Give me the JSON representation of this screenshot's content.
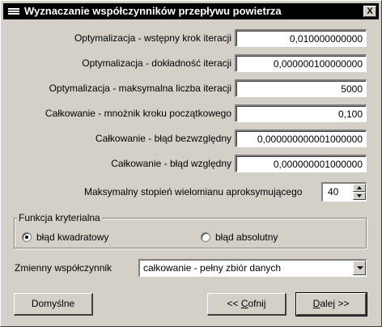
{
  "window": {
    "title": "Wyznaczanie współczynników przepływu powietrza",
    "close_label": "X",
    "icon": "app-menu-icon"
  },
  "fields": [
    {
      "label": "Optymalizacja - wstępny krok iteracji",
      "value": "0,010000000000"
    },
    {
      "label": "Optymalizacja - dokładność iteracji",
      "value": "0,000000100000000"
    },
    {
      "label": "Optymalizacja - maksymalna liczba iteracji",
      "value": "5000"
    },
    {
      "label": "Całkowanie - mnożnik kroku początkowego",
      "value": "0,100"
    },
    {
      "label": "Całkowanie - błąd bezwzględny",
      "value": "0,000000000001000000"
    },
    {
      "label": "Całkowanie - błąd względny",
      "value": "0,000000001000000"
    }
  ],
  "spinner": {
    "label": "Maksymalny stopień wielomianu aproksymującego",
    "value": "40"
  },
  "criterion_group": {
    "title": "Funkcja kryterialna",
    "options": [
      {
        "label": "błąd kwadratowy",
        "selected": true
      },
      {
        "label": "błąd absolutny",
        "selected": false
      }
    ]
  },
  "variable_combo": {
    "label": "Zmienny współczynnik",
    "value": "całkowanie - pełny zbiór danych"
  },
  "buttons": {
    "defaults": "Domyślne",
    "back_prefix": "<< ",
    "back_hotkey": "C",
    "back_rest": "ofnij",
    "next_hotkey": "D",
    "next_rest": "alej >>"
  }
}
